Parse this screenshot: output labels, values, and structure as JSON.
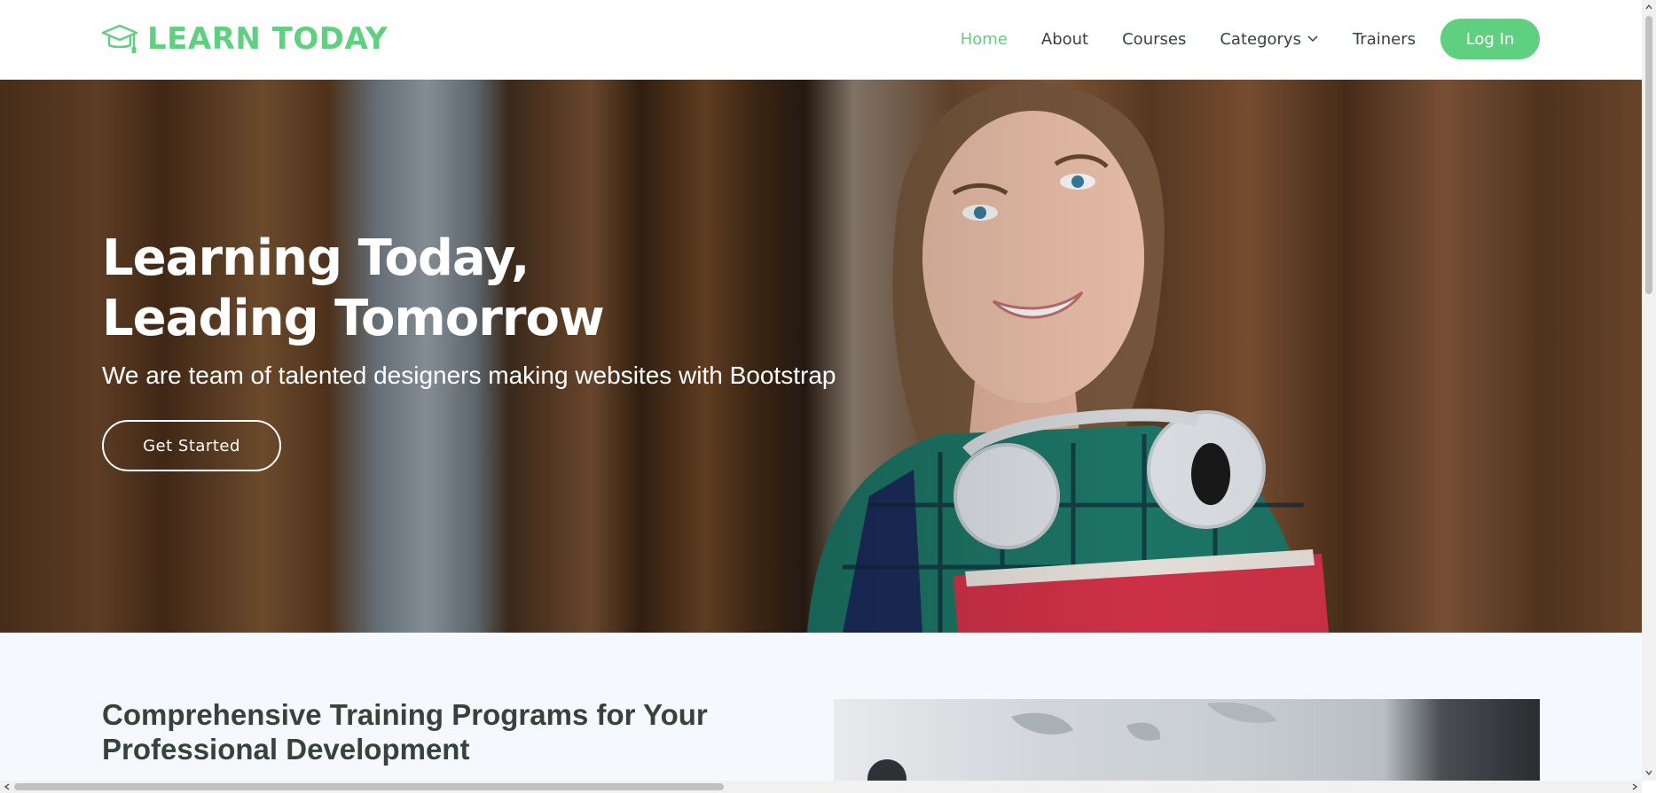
{
  "brand": {
    "name": "LEARN TODAY",
    "icon": "graduation-cap-icon"
  },
  "nav": {
    "items": [
      {
        "label": "Home",
        "active": true
      },
      {
        "label": "About",
        "active": false
      },
      {
        "label": "Courses",
        "active": false
      },
      {
        "label": "Categorys",
        "active": false,
        "dropdown": true,
        "icon": "chevron-down-icon"
      },
      {
        "label": "Trainers",
        "active": false
      }
    ],
    "login_label": "Log In"
  },
  "hero": {
    "title_line1": "Learning Today,",
    "title_line2": "Leading Tomorrow",
    "subtitle": "We are team of talented designers making websites with Bootstrap",
    "cta_label": "Get Started"
  },
  "about": {
    "title": "Comprehensive Training Programs for Your Professional Development"
  },
  "colors": {
    "accent": "#5fcf80",
    "text_dark": "#37423b",
    "section_bg": "#f5f8fd"
  }
}
